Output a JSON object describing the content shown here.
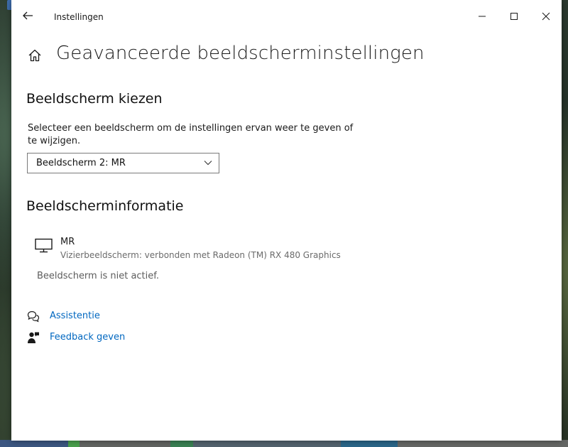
{
  "window": {
    "title": "Instellingen",
    "page_title": "Geavanceerde beeldscherminstellingen"
  },
  "choose_display": {
    "heading": "Beeldscherm kiezen",
    "description": "Selecteer een beeldscherm om de instellingen ervan weer te geven of te wijzigen.",
    "selected_display": "Beeldscherm 2: MR"
  },
  "display_info": {
    "heading": "Beeldscherminformatie",
    "name": "MR",
    "detail": "Vizierbeeldscherm: verbonden met Radeon (TM) RX 480 Graphics",
    "status": "Beeldscherm is niet actief."
  },
  "links": [
    {
      "label": "Assistentie",
      "icon": "help-chat-icon"
    },
    {
      "label": "Feedback geven",
      "icon": "feedback-person-icon"
    }
  ],
  "colors": {
    "accent_link": "#0067c0",
    "window_bg": "#ffffff"
  }
}
